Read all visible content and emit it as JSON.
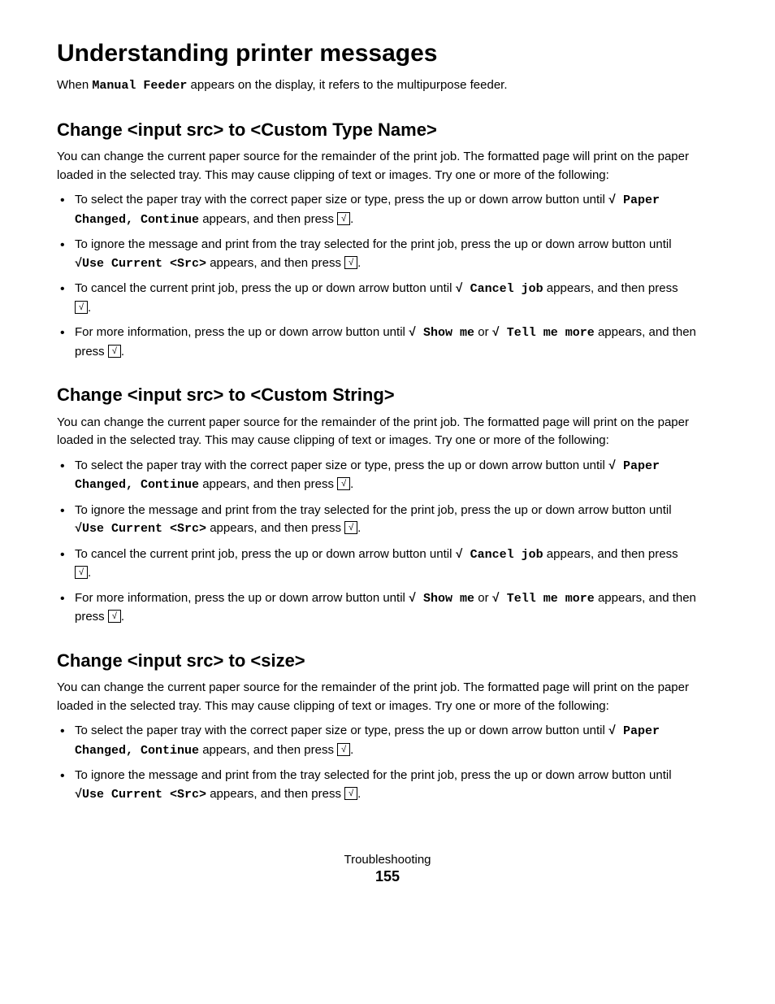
{
  "page": {
    "title": "Understanding printer messages",
    "intro": {
      "prefix": "When ",
      "code": "Manual Feeder",
      "suffix": " appears on the display, it refers to the multipurpose feeder."
    },
    "sections": [
      {
        "heading": "Change <input src> to <Custom Type Name>",
        "body": "You can change the current paper source for the remainder of the print job. The formatted page will print on the paper loaded in the selected tray. This may cause clipping of text or images. Try one or more of the following:",
        "bullets": [
          {
            "text_before": "To select the paper tray with the correct paper size or type, press the up or down arrow button until ",
            "check_code": "Paper Changed, Continue",
            "text_after": " appears, and then press",
            "has_checkbox": true,
            "has_continuation": false
          },
          {
            "text_before": "To ignore the message and print from the tray selected for the print job, press the up or down arrow button until",
            "check_code": "Use Current <Src>",
            "text_after": " appears, and then press",
            "has_checkbox": true,
            "new_line_code": true
          },
          {
            "text_before": "To cancel the current print job, press the up or down arrow button until ",
            "check_code": "Cancel job",
            "text_after": " appears, and then press",
            "has_checkbox": true,
            "has_continuation": true,
            "continuation_checkbox": true
          },
          {
            "text_before": "For more information, press the up or down arrow button until ",
            "check_code": "Show me",
            "text_middle": " or ",
            "check_code2": "Tell me more",
            "text_after": " appears, and then press",
            "has_checkbox": true,
            "has_continuation": false,
            "two_codes": true
          }
        ]
      },
      {
        "heading": "Change <input src> to <Custom String>",
        "body": "You can change the current paper source for the remainder of the print job. The formatted page will print on the paper loaded in the selected tray. This may cause clipping of text or images. Try one or more of the following:",
        "bullets": [
          {
            "text_before": "To select the paper tray with the correct paper size or type, press the up or down arrow button until ",
            "check_code": "Paper Changed, Continue",
            "text_after": " appears, and then press",
            "has_checkbox": true
          },
          {
            "text_before": "To ignore the message and print from the tray selected for the print job, press the up or down arrow button until",
            "check_code": "Use Current <Src>",
            "text_after": " appears, and then press",
            "has_checkbox": true,
            "new_line_code": true
          },
          {
            "text_before": "To cancel the current print job, press the up or down arrow button until ",
            "check_code": "Cancel job",
            "text_after": " appears, and then press",
            "has_checkbox": true,
            "has_continuation": true
          },
          {
            "text_before": "For more information, press the up or down arrow button until ",
            "check_code": "Show me",
            "text_middle": " or ",
            "check_code2": "Tell me more",
            "text_after": " appears, and then press",
            "has_checkbox": true,
            "two_codes": true
          }
        ]
      },
      {
        "heading": "Change <input src> to <size>",
        "body": "You can change the current paper source for the remainder of the print job. The formatted page will print on the paper loaded in the selected tray. This may cause clipping of text or images. Try one or more of the following:",
        "bullets": [
          {
            "text_before": "To select the paper tray with the correct paper size or type, press the up or down arrow button until ",
            "check_code": "Paper Changed, Continue",
            "text_after": " appears, and then press",
            "has_checkbox": true
          },
          {
            "text_before": "To ignore the message and print from the tray selected for the print job, press the up or down arrow button until",
            "check_code": "Use Current <Src>",
            "text_after": " appears, and then press",
            "has_checkbox": true,
            "new_line_code": true
          }
        ]
      }
    ],
    "footer": {
      "label": "Troubleshooting",
      "page_number": "155"
    }
  }
}
